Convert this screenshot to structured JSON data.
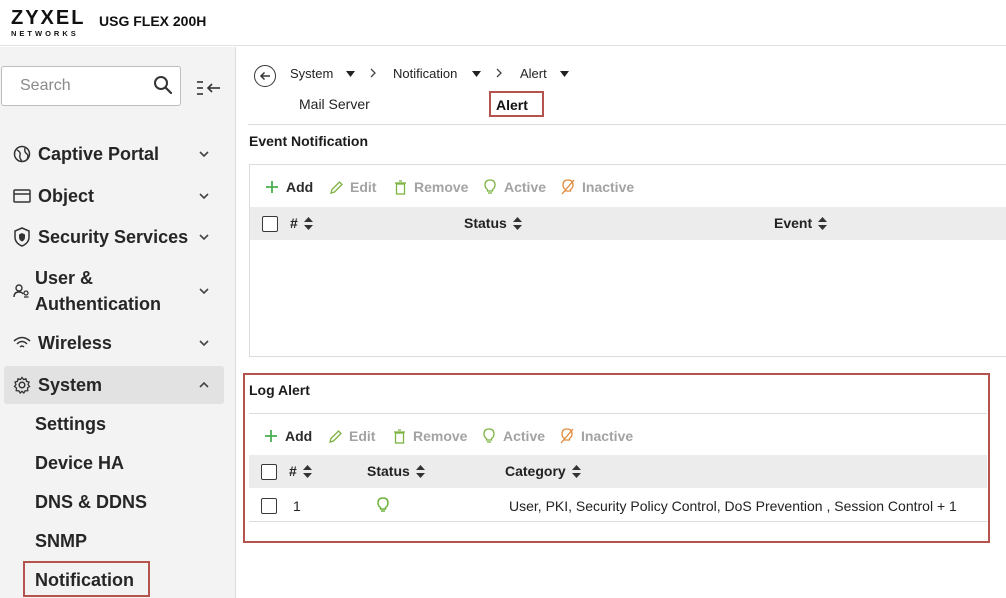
{
  "header": {
    "brand": "ZYXEL",
    "brand_sub": "NETWORKS",
    "device_name": "USG FLEX 200H"
  },
  "sidebar": {
    "search_placeholder": "Search",
    "items": [
      {
        "label": "Captive Portal",
        "icon": "globe-icon"
      },
      {
        "label": "Object",
        "icon": "object-icon"
      },
      {
        "label": "Security Services",
        "icon": "shield-icon"
      },
      {
        "label": "User &",
        "label2": "Authentication",
        "icon": "users-icon"
      },
      {
        "label": "Wireless",
        "icon": "wifi-icon"
      },
      {
        "label": "System",
        "icon": "gear-icon"
      }
    ],
    "system_sub": [
      "Settings",
      "Device HA",
      "DNS & DDNS",
      "SNMP",
      "Notification"
    ]
  },
  "breadcrumb": {
    "items": [
      "System",
      "Notification",
      "Alert"
    ],
    "tabs": [
      "Mail Server",
      "Alert"
    ]
  },
  "event_notification": {
    "title": "Event Notification",
    "toolbar": {
      "add": "Add",
      "edit": "Edit",
      "remove": "Remove",
      "active": "Active",
      "inactive": "Inactive"
    },
    "columns": [
      "#",
      "Status",
      "Event"
    ],
    "rows": []
  },
  "log_alert": {
    "title": "Log Alert",
    "toolbar": {
      "add": "Add",
      "edit": "Edit",
      "remove": "Remove",
      "active": "Active",
      "inactive": "Inactive"
    },
    "columns": [
      "#",
      "Status",
      "Category"
    ],
    "rows": [
      {
        "index": "1",
        "status": "active",
        "category": "User, PKI, Security Policy Control, DoS Prevention , Session Control + 1"
      }
    ]
  },
  "colors": {
    "highlight": "#b5534e",
    "add_green": "#4caf50",
    "active_green": "#7cb342",
    "inactive_orange": "#e08a3c"
  }
}
